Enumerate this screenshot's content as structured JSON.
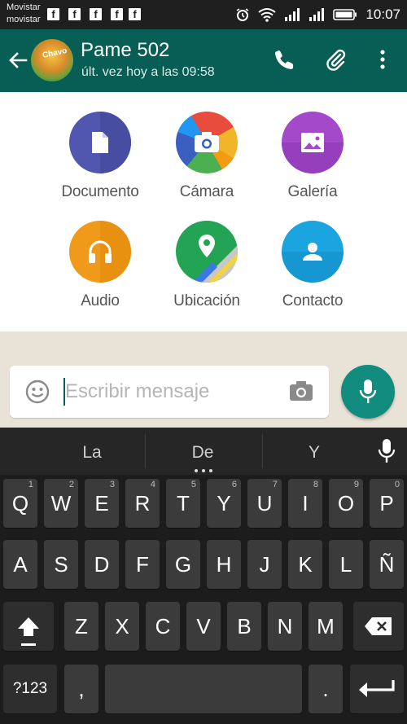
{
  "status_bar": {
    "carrier_1": "Movistar",
    "carrier_2": "movistar",
    "notification_icons": [
      "facebook-icon",
      "facebook-icon",
      "facebook-icon",
      "facebook-icon",
      "facebook-icon"
    ],
    "facebook_glyph": "f",
    "time": "10:07"
  },
  "header": {
    "contact_name": "Pame 502",
    "last_seen": "últ. vez hoy a las 09:58",
    "avatar_text": "Chavo"
  },
  "attachments": [
    {
      "label": "Documento",
      "icon": "document-icon",
      "color": "#5157ae"
    },
    {
      "label": "Cámara",
      "icon": "camera-icon",
      "color": "#e74c3c"
    },
    {
      "label": "Galería",
      "icon": "gallery-icon",
      "color": "#a349c9"
    },
    {
      "label": "Audio",
      "icon": "headphones-icon",
      "color": "#f09a1c"
    },
    {
      "label": "Ubicación",
      "icon": "location-icon",
      "color": "#23a455"
    },
    {
      "label": "Contacto",
      "icon": "contact-icon",
      "color": "#1ba5e0"
    }
  ],
  "composer": {
    "placeholder": "Escribir mensaje"
  },
  "keyboard": {
    "suggestions": [
      "La",
      "De",
      "Y"
    ],
    "row1": [
      {
        "label": "Q",
        "hint": "1"
      },
      {
        "label": "W",
        "hint": "2"
      },
      {
        "label": "E",
        "hint": "3"
      },
      {
        "label": "R",
        "hint": "4"
      },
      {
        "label": "T",
        "hint": "5"
      },
      {
        "label": "Y",
        "hint": "6"
      },
      {
        "label": "U",
        "hint": "7"
      },
      {
        "label": "I",
        "hint": "8"
      },
      {
        "label": "O",
        "hint": "9"
      },
      {
        "label": "P",
        "hint": "0"
      }
    ],
    "row2": [
      "A",
      "S",
      "D",
      "F",
      "G",
      "H",
      "J",
      "K",
      "L",
      "Ñ"
    ],
    "row3": [
      "Z",
      "X",
      "C",
      "V",
      "B",
      "N",
      "M"
    ],
    "symbols_label": "?123",
    "comma_label": ",",
    "period_label": "."
  },
  "colors": {
    "header_bg": "#075e54",
    "status_bar_bg": "#1f1f1f",
    "send_button": "#118c7e",
    "chat_bg": "#e9e2d6",
    "keyboard_bg": "#1c1c1c",
    "key_bg": "#3b3b3b"
  }
}
